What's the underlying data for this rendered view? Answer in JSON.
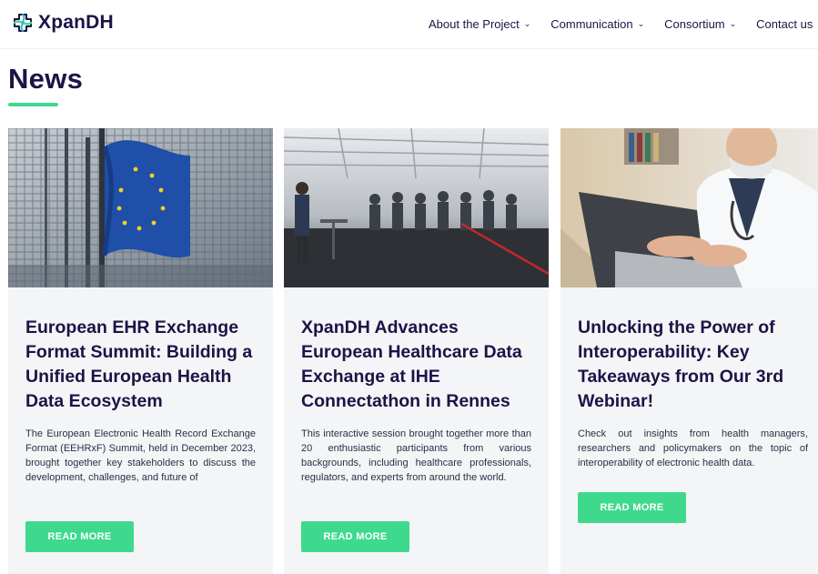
{
  "header": {
    "logo_text": "XpanDH",
    "nav": [
      {
        "label": "About the Project",
        "chevron": "⌄"
      },
      {
        "label": "Communication",
        "chevron": "⌄"
      },
      {
        "label": "Consortium",
        "chevron": "⌄"
      },
      {
        "label": "Contact us",
        "chevron": ""
      }
    ]
  },
  "page": {
    "title": "News",
    "accent_color": "#3fd98e"
  },
  "cards": [
    {
      "title": "European EHR Exchange Format Summit: Building a Unified European Health Data Ecosystem",
      "excerpt": "The European Electronic Health Record Exchange Format (EEHRxF) Summit, held in December 2023, brought together key stakeholders to discuss the development, challenges, and future of",
      "button": "READ MORE",
      "image": "eu-flag-photo"
    },
    {
      "title": "XpanDH Advances European Healthcare Data Exchange at IHE Connectathon in Rennes",
      "excerpt": "This interactive session brought together more than 20 enthusiastic participants from various backgrounds, including healthcare professionals, regulators, and experts from around the world.",
      "button": "READ MORE",
      "image": "conference-hall-photo"
    },
    {
      "title": "Unlocking the Power of Interoperability: Key Takeaways from Our 3rd Webinar!",
      "excerpt": "Check out insights from health managers, researchers and policymakers on the topic of interoperability of electronic health data.",
      "button": "READ MORE",
      "image": "doctor-laptop-photo"
    }
  ]
}
